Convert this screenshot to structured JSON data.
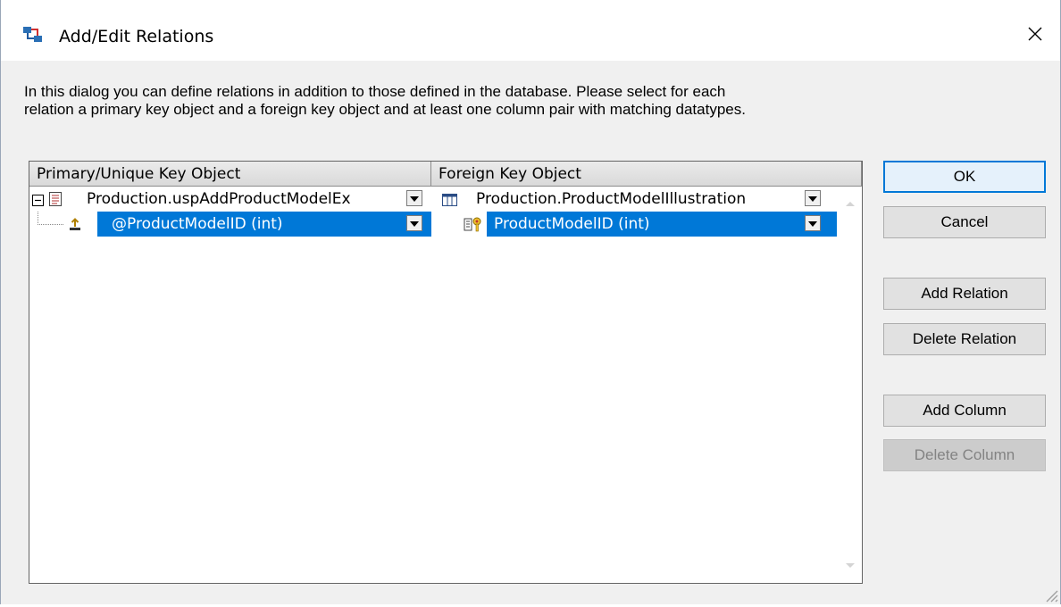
{
  "window": {
    "title": "Add/Edit Relations",
    "app_icon": "relations-icon",
    "close_icon": "close-icon"
  },
  "intro": {
    "line1": "In this dialog you can define relations in addition to those defined in the database.  Please select for each",
    "line2": "relation a primary key object and a foreign key object and at least one column pair with matching datatypes."
  },
  "grid": {
    "columns": [
      "Primary/Unique Key Object",
      "Foreign Key Object"
    ],
    "rows": [
      {
        "primary": "Production.uspAddProductModelEx",
        "primary_icon": "stored-procedure-icon",
        "foreign": "Production.ProductModelIllustration",
        "foreign_icon": "table-icon",
        "expanded": true,
        "selected": false
      },
      {
        "primary": "@ProductModelID (int)",
        "primary_icon": "parameter-icon",
        "foreign": "ProductModelID (int)",
        "foreign_icon": "key-column-icon",
        "selected": true
      }
    ]
  },
  "buttons": {
    "ok": "OK",
    "cancel": "Cancel",
    "add_relation": "Add Relation",
    "delete_relation": "Delete Relation",
    "add_column": "Add Column",
    "delete_column": "Delete Column"
  },
  "colors": {
    "selection": "#0078d7",
    "header": "#d9d9d9",
    "dialog_bg": "#f0f0f0"
  }
}
